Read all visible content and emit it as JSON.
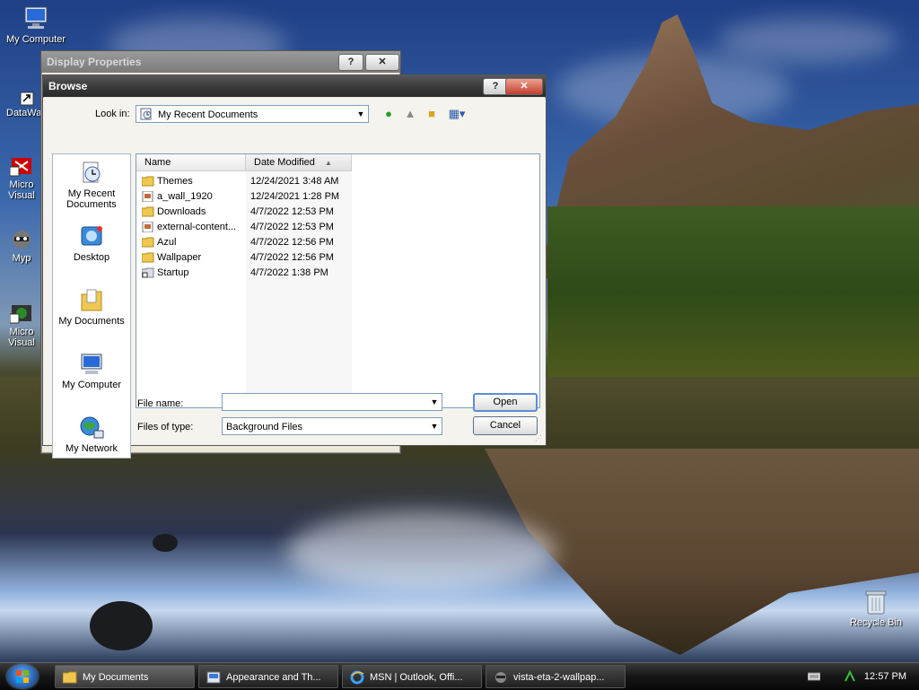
{
  "desktop": {
    "icons": [
      {
        "label": "My Computer"
      },
      {
        "label": "DataWa"
      },
      {
        "label": "Micro Visual"
      },
      {
        "label": "Myp"
      },
      {
        "label": "Micro Visual"
      },
      {
        "label": "Recycle Bin"
      }
    ]
  },
  "bg_window": {
    "title": "Display Properties",
    "help_label": "?",
    "close_label": "✕"
  },
  "dialog": {
    "title": "Browse",
    "help_label": "?",
    "close_label": "✕",
    "look_in_label": "Look in:",
    "look_in_value": "My Recent Documents",
    "places": [
      {
        "label": "My Recent Documents",
        "icon": "recent-documents-icon"
      },
      {
        "label": "Desktop",
        "icon": "desktop-icon"
      },
      {
        "label": "My Documents",
        "icon": "my-documents-icon"
      },
      {
        "label": "My Computer",
        "icon": "my-computer-icon"
      },
      {
        "label": "My Network",
        "icon": "my-network-icon"
      }
    ],
    "columns": {
      "name": "Name",
      "date": "Date Modified"
    },
    "files": [
      {
        "name": "Themes",
        "date": "12/24/2021 3:48 AM"
      },
      {
        "name": "a_wall_1920",
        "date": "12/24/2021 1:28 PM"
      },
      {
        "name": "Downloads",
        "date": "4/7/2022 12:53 PM"
      },
      {
        "name": "external-content...",
        "date": "4/7/2022 12:53 PM"
      },
      {
        "name": "Azul",
        "date": "4/7/2022 12:56 PM"
      },
      {
        "name": "Wallpaper",
        "date": "4/7/2022 12:56 PM"
      },
      {
        "name": "Startup",
        "date": "4/7/2022 1:38 PM"
      }
    ],
    "file_name_label": "File name:",
    "file_name_value": "",
    "files_of_type_label": "Files of type:",
    "files_of_type_value": "Background Files",
    "open_label": "Open",
    "cancel_label": "Cancel"
  },
  "taskbar": {
    "tasks": [
      {
        "label": "My Documents"
      },
      {
        "label": "Appearance and Th..."
      },
      {
        "label": "MSN | Outlook, Offi..."
      },
      {
        "label": "vista-eta-2-wallpap..."
      }
    ],
    "clock": "12:57 PM"
  }
}
